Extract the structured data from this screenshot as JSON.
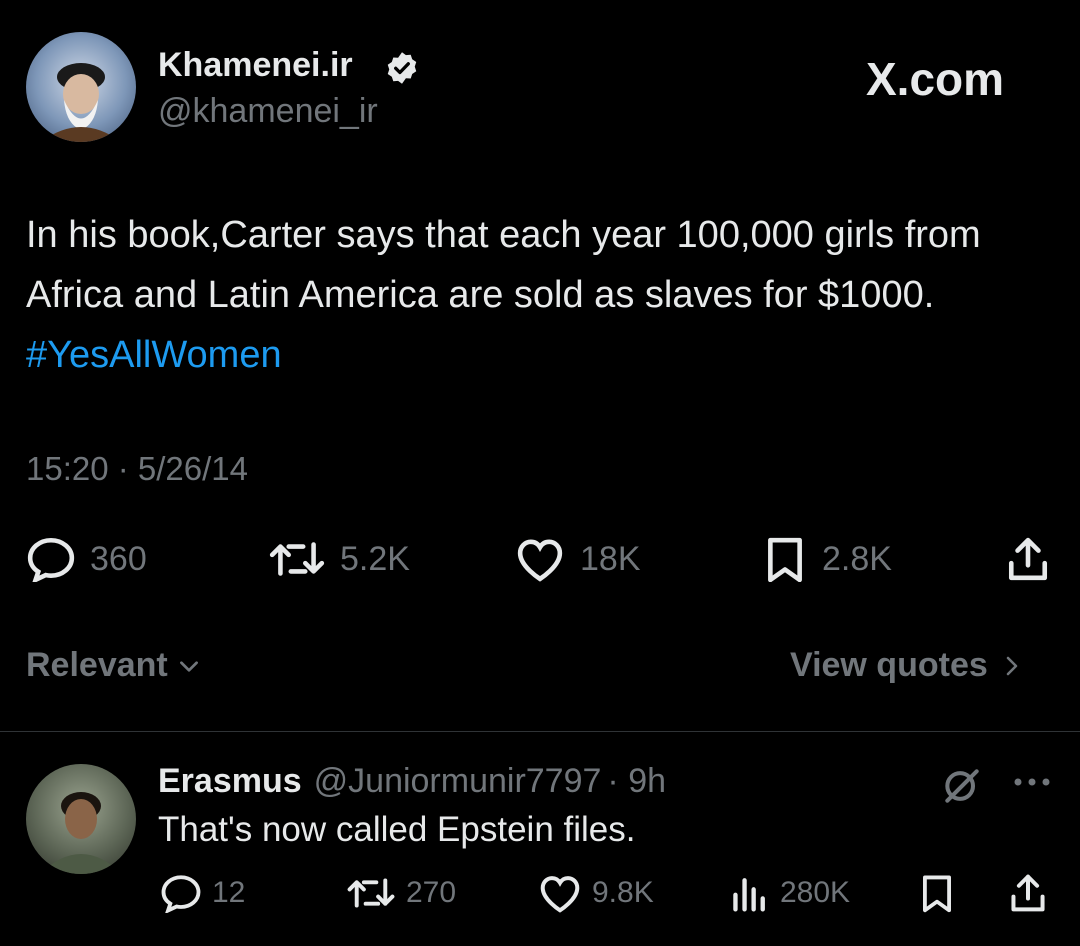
{
  "brand": {
    "watermark": "X.com"
  },
  "tweet": {
    "author_name": "Khamenei.ir",
    "author_handle": "@khamenei_ir",
    "text_main": "In his book,Carter says that each year 100,000 girls from Africa and Latin America are sold as slaves for $1000.",
    "hashtag": "#YesAllWomen",
    "timestamp": "15:20 · 5/26/14",
    "stats": {
      "replies": "360",
      "reposts": "5.2K",
      "likes": "18K",
      "bookmarks": "2.8K"
    }
  },
  "replies_bar": {
    "sort_label": "Relevant",
    "view_quotes_label": "View quotes"
  },
  "reply": {
    "author_name": "Erasmus",
    "author_handle": "@Juniormunir7797",
    "time": "· 9h",
    "text": "That's now called Epstein files.",
    "stats": {
      "replies": "12",
      "reposts": "270",
      "likes": "9.8K",
      "views": "280K"
    }
  },
  "colors": {
    "background": "#000000",
    "text": "#e7e9ea",
    "muted": "#71767b",
    "link": "#1d9bf0",
    "divider": "#2f3336"
  }
}
